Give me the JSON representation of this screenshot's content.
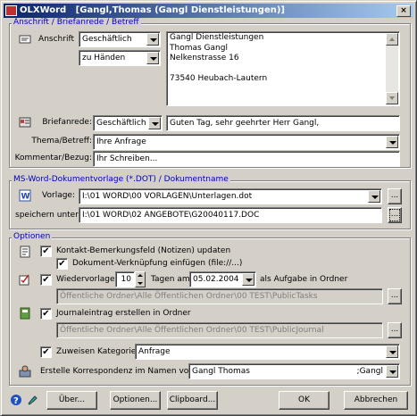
{
  "window": {
    "app_name": "OLXWord",
    "title": "[Gangl,Thomas (Gangl Dienstleistungen)]"
  },
  "address_group": {
    "title": "Anschrift / Briefanrede / Betreff",
    "anschrift_label": "Anschrift",
    "anschrift_type": "Geschäftlich",
    "attention": "zu Händen",
    "address_lines": [
      "Gangl Dienstleistungen",
      "Thomas Gangl",
      "Nelkenstrasse 16",
      "",
      "73540 Heubach-Lautern"
    ],
    "salutation_label": "Briefanrede:",
    "salutation_type": "Geschäftlich",
    "salutation_text": "Guten Tag, sehr geehrter Herr Gangl,",
    "subject_label": "Thema/Betreff:",
    "subject_value": "Ihre Anfrage",
    "comment_label": "Kommentar/Bezug:",
    "comment_value": "Ihr Schreiben..."
  },
  "template_group": {
    "title": "MS-Word-Dokumentvorlage (*.DOT) / Dokumentname",
    "template_label": "Vorlage:",
    "template_value": "I:\\01 WORD\\00 VORLAGEN\\Unterlagen.dot",
    "save_label": "speichern unter:",
    "save_value": "I:\\01 WORD\\02 ANGEBOTE\\G20040117.DOC"
  },
  "options_group": {
    "title": "Optionen",
    "contact_notes_label": "Kontakt-Bemerkungsfeld (Notizen) updaten",
    "doc_link_label": "Dokument-Verknüpfung einfügen (file://...)",
    "resubmit_label": "Wiedervorlage in",
    "resubmit_days": "10",
    "resubmit_days_suffix": "Tagen am",
    "resubmit_date": "05.02.2004",
    "resubmit_target": "als Aufgabe in Ordner",
    "tasks_folder": "Öffentliche Ordner\\Alle Öffentlichen Ordner\\00 TEST\\PublicTasks",
    "journal_label": "Journaleintrag erstellen in Ordner",
    "journal_folder": "Öffentliche Ordner\\Alle Öffentlichen Ordner\\00 TEST\\PublicJournal",
    "category_label": "Zuweisen Kategorie:",
    "category_value": "Anfrage",
    "on_behalf_label": "Erstelle Korrespondenz im Namen von:",
    "on_behalf_value": "Gangl Thomas",
    "on_behalf_value_right": ";Gangl"
  },
  "buttons": {
    "about": "Über...",
    "options": "Optionen...",
    "clipboard": "Clipboard...",
    "ok": "OK",
    "cancel": "Abbrechen"
  },
  "ellipsis": "...",
  "checks": {
    "contact_notes": "✔",
    "doc_link": "✔",
    "resubmit": "✔",
    "journal": "✔",
    "category": "✔"
  },
  "colors": {
    "group_title": "#0000c0",
    "titlebar_start": "#0a246a",
    "titlebar_end": "#a6caf0"
  }
}
